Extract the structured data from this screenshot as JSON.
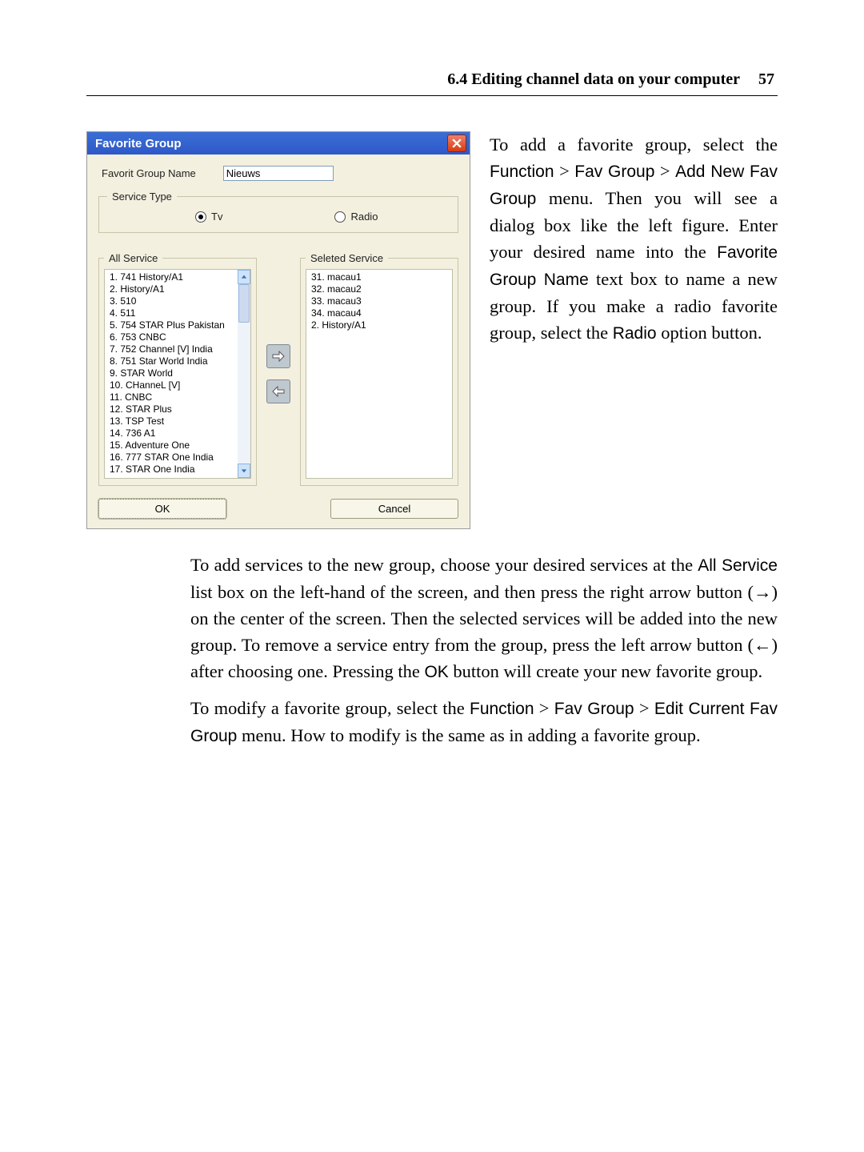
{
  "header": {
    "section": "6.4 Editing channel data on your computer",
    "page": "57"
  },
  "dialog": {
    "title": "Favorite Group",
    "name_label": "Favorit Group Name",
    "name_value": "Nieuws",
    "service_type_legend": "Service Type",
    "tv_label": "Tv",
    "radio_label": "Radio",
    "all_service_legend": "All Service",
    "selected_service_legend": "Seleted Service",
    "ok": "OK",
    "cancel": "Cancel",
    "all": {
      "i1": "1. 741 History/A1",
      "i2": "2. History/A1",
      "i3": "3. 510",
      "i4": "4. 511",
      "i5": "5. 754 STAR Plus Pakistan",
      "i6": "6. 753 CNBC",
      "i7": "7. 752 Channel [V] India",
      "i8": "8. 751 Star World India",
      "i9": "9. STAR World",
      "i10": "10. CHanneL [V]",
      "i11": "11. CNBC",
      "i12": "12. STAR Plus",
      "i13": "13. TSP Test",
      "i14": "14. 736 A1",
      "i15": "15. Adventure One",
      "i16": "16. 777 STAR One India",
      "i17": "17. STAR One India"
    },
    "sel": {
      "i1": "31. macau1",
      "i2": "32. macau2",
      "i3": "33. macau3",
      "i4": "34. macau4",
      "i5": "2. History/A1"
    }
  },
  "icons": {
    "close": "close-icon",
    "arrow_right": "arrow-right-icon",
    "arrow_left": "arrow-left-icon",
    "scroll_up": "scroll-up-icon",
    "scroll_down": "scroll-down-icon"
  },
  "para1": {
    "a": "To add a favorite group, select the ",
    "fn": "Function",
    "gt1": " > ",
    "fav": "Fav Group",
    "gt2": " > ",
    "add": "Add New Fav Group",
    "b": " menu.  Then you will see a dialog box like the left figure.  Enter your desired name into the ",
    "fgbox": "Favorite Group Name",
    "c": " text box to name a new group.  If you make a radio favorite group, select the ",
    "radio": "Radio",
    "d": " option button."
  },
  "para2": {
    "a": "To add services to the new group, choose your desired services at the ",
    "allsvc": "All Service",
    "b": " list box on the left-hand of the screen, and then press the right arrow button (→) on the center of the screen. Then the selected services will be added into the new group. To remove a service entry from the group, press the left arrow button (←) after choosing one. Pressing the ",
    "ok": "OK",
    "c": " button will create your new favorite group."
  },
  "para3": {
    "a": "To modify a favorite group, select the ",
    "fn": "Function",
    "gt1": " > ",
    "fav": "Fav Group",
    "gt2": " > ",
    "edit": "Edit Current Fav Group",
    "b": " menu. How to modify is the same as in adding a favorite group."
  }
}
